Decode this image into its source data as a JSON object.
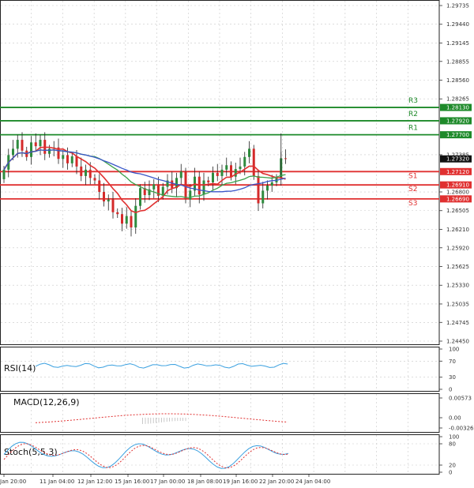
{
  "colors": {
    "bull": "#2e8b3e",
    "bear": "#d42a2a",
    "resistance": "#1e8a2a",
    "support": "#e03030",
    "ma_red": "#e03030",
    "ma_green": "#3aa04a",
    "ma_blue": "#3a56c8",
    "osc_blue": "#3aa0e0",
    "grid": "#c8c8c8"
  },
  "price_axis": {
    "ticks": [
      "1.29735",
      "1.29440",
      "1.29145",
      "1.28855",
      "1.28560",
      "1.28265",
      "1.27385",
      "1.26800",
      "1.26505",
      "1.26210",
      "1.25920",
      "1.25625",
      "1.25330",
      "1.25035",
      "1.24745",
      "1.24450"
    ]
  },
  "levels": [
    {
      "name": "R3",
      "value": 1.2813,
      "value_label": "1.28130",
      "kind": "resistance"
    },
    {
      "name": "R2",
      "value": 1.2792,
      "value_label": "1.27920",
      "kind": "resistance"
    },
    {
      "name": "R1",
      "value": 1.277,
      "value_label": "1.27700",
      "kind": "resistance"
    },
    {
      "name": "S1",
      "value": 1.2712,
      "value_label": "1.27120",
      "kind": "support"
    },
    {
      "name": "S2",
      "value": 1.2691,
      "value_label": "1.26910",
      "kind": "support"
    },
    {
      "name": "S3",
      "value": 1.2669,
      "value_label": "1.26690",
      "kind": "support"
    }
  ],
  "current_price": {
    "value": 1.2732,
    "label": "1.27320"
  },
  "x_axis": {
    "labels": [
      "Jan 20:00",
      "11 Jan 04:00",
      "12 Jan 12:00",
      "15 Jan 16:00",
      "17 Jan 00:00",
      "18 Jan 08:00",
      "19 Jan 16:00",
      "22 Jan 20:00",
      "24 Jan 04:00"
    ]
  },
  "panels": {
    "rsi": {
      "title": "RSI(14)",
      "ticks": [
        "100",
        "70",
        "30",
        "0"
      ]
    },
    "macd": {
      "title": "MACD(12,26,9)",
      "ticks": [
        "0.00573",
        "0.00",
        "-0.003269"
      ]
    },
    "stoch": {
      "title": "Stoch(5,5,3)",
      "ticks": [
        "100",
        "80",
        "20",
        "0"
      ]
    }
  },
  "chart_data": {
    "type": "candlestick",
    "ylim": [
      1.2445,
      1.2976
    ],
    "horizontal_levels": [
      1.2813,
      1.2792,
      1.277,
      1.2712,
      1.2691,
      1.2669
    ],
    "last_price": 1.2732,
    "close_approx": [
      1.2715,
      1.2738,
      1.2748,
      1.2762,
      1.2745,
      1.2735,
      1.2758,
      1.2752,
      1.2762,
      1.274,
      1.2748,
      1.275,
      1.2732,
      1.2738,
      1.2725,
      1.2736,
      1.272,
      1.2705,
      1.2715,
      1.2702,
      1.2698,
      1.268,
      1.2665,
      1.2668,
      1.2648,
      1.2645,
      1.263,
      1.2642,
      1.2624,
      1.2658,
      1.2686,
      1.2675,
      1.2684,
      1.2692,
      1.2674,
      1.2688,
      1.2698,
      1.2686,
      1.2702,
      1.2712,
      1.2668,
      1.2682,
      1.2704,
      1.2676,
      1.2698,
      1.2695,
      1.271,
      1.2705,
      1.2715,
      1.2722,
      1.2704,
      1.2716,
      1.272,
      1.2735,
      1.2748,
      1.2705,
      1.2662,
      1.2682,
      1.269,
      1.2695,
      1.2702,
      1.2733,
      1.2732
    ],
    "rsi_range": [
      0,
      100
    ],
    "stoch_range": [
      0,
      100
    ]
  }
}
